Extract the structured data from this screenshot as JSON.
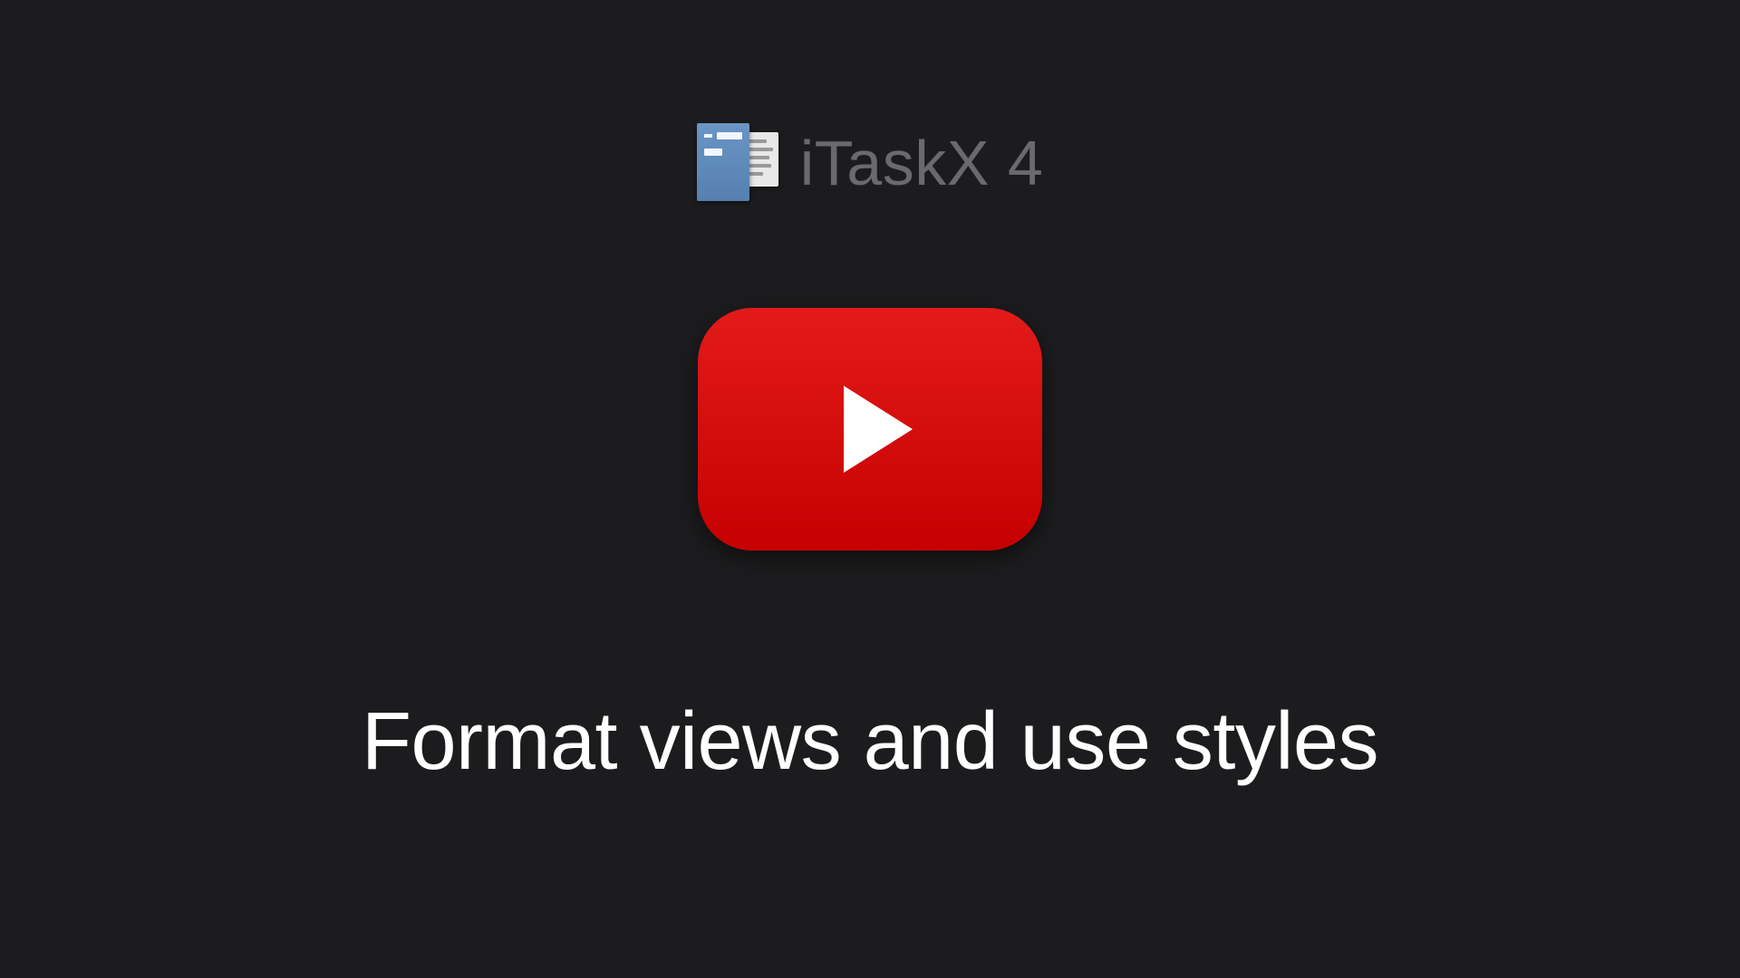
{
  "header": {
    "app_name": "iTaskX 4"
  },
  "main": {
    "title": "Format views and use styles"
  },
  "icons": {
    "play": "play-icon",
    "app_logo": "itaskx-logo"
  }
}
